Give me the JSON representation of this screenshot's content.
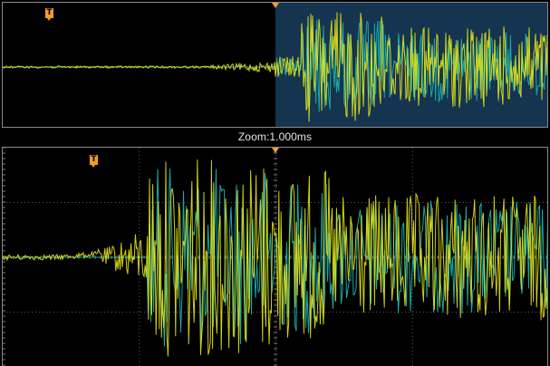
{
  "overview": {
    "trigger_marker_label": "T",
    "zoom_window_color": "#15344f"
  },
  "zoom": {
    "label": "Zoom:1.000ms"
  },
  "main": {
    "trigger_marker_label": "T"
  },
  "colors": {
    "channel1": "#e6e619",
    "channel2": "#1aa8a8",
    "grid": "#5a5a5a",
    "marker": "#f39c2b"
  },
  "icons": {
    "trigger": "trigger-marker-icon",
    "center": "center-marker-icon"
  }
}
